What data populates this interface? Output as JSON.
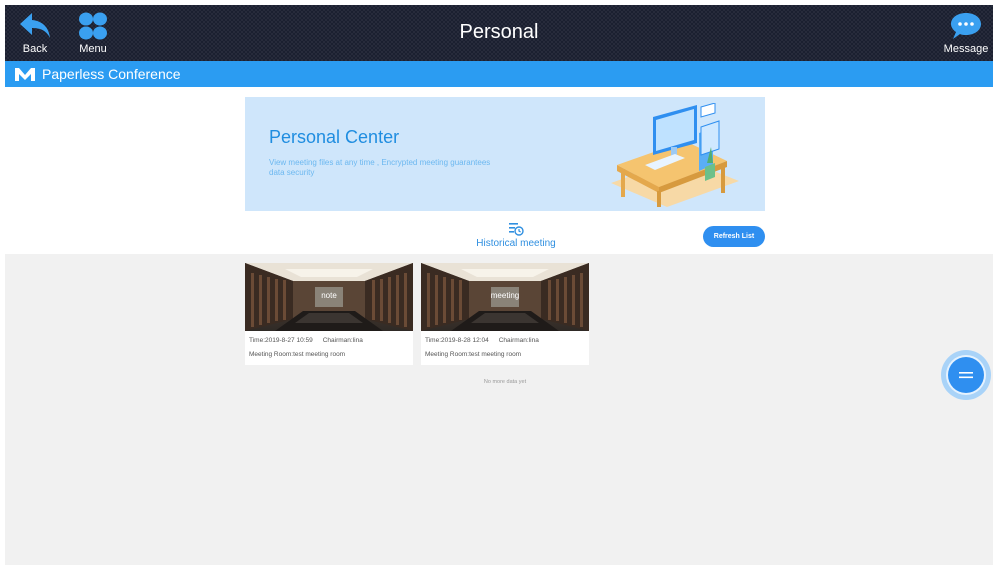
{
  "header": {
    "back_label": "Back",
    "menu_label": "Menu",
    "title": "Personal",
    "message_label": "Message"
  },
  "brand": {
    "name": "Paperless Conference"
  },
  "banner": {
    "title": "Personal Center",
    "description": "View meeting files at any time , Encrypted meeting guarantees data security"
  },
  "tabs": {
    "historical_label": "Historical meeting"
  },
  "actions": {
    "refresh_label": "Refresh List"
  },
  "meetings": [
    {
      "name": "note",
      "time": "Time:2019-8-27 10:59",
      "chairman": "Chairman:lina",
      "room": "Meeting Room:test meeting room"
    },
    {
      "name": "meeting",
      "time": "Time:2019-8-28 12:04",
      "chairman": "Chairman:lina",
      "room": "Meeting Room:test meeting room"
    }
  ],
  "list_footer": "No more data yet",
  "colors": {
    "accent": "#2b9cf2",
    "header_bg": "#1b2030",
    "page_bg": "#f1f1f1"
  }
}
